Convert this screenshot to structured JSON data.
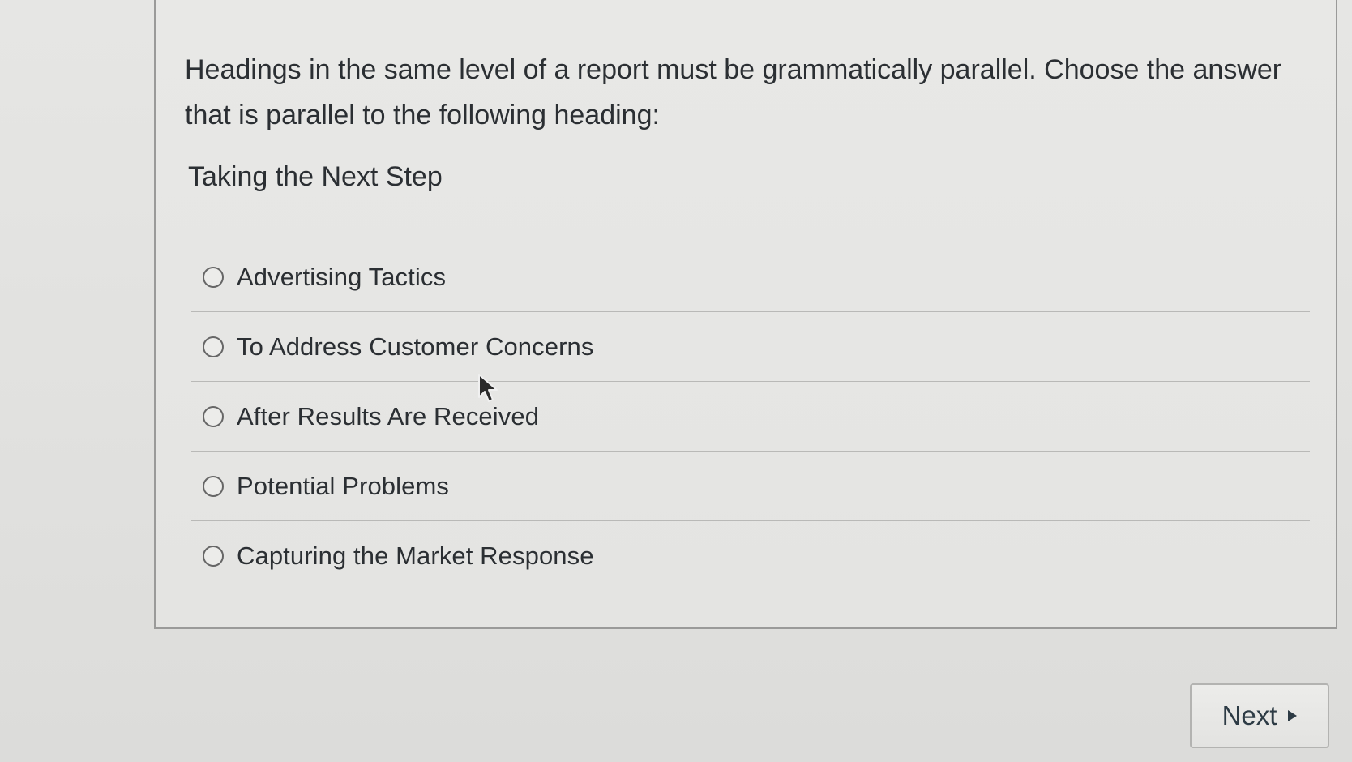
{
  "question": {
    "prompt": "Headings in the same level of a report must be grammatically parallel. Choose the answer that is parallel to the following heading:",
    "example_heading": "Taking the Next Step",
    "answers": [
      {
        "label": "Advertising Tactics"
      },
      {
        "label": "To Address Customer Concerns"
      },
      {
        "label": "After Results Are Received"
      },
      {
        "label": "Potential Problems"
      },
      {
        "label": "Capturing the Market Response"
      }
    ]
  },
  "navigation": {
    "next_label": "Next",
    "next_icon": "play-arrow-right-icon"
  },
  "cursor": {
    "icon": "mouse-pointer-icon"
  },
  "colors": {
    "text": "#2b2f33",
    "divider": "#b9b9b7",
    "border": "#9a9a99",
    "background": "#e4e4e2"
  }
}
